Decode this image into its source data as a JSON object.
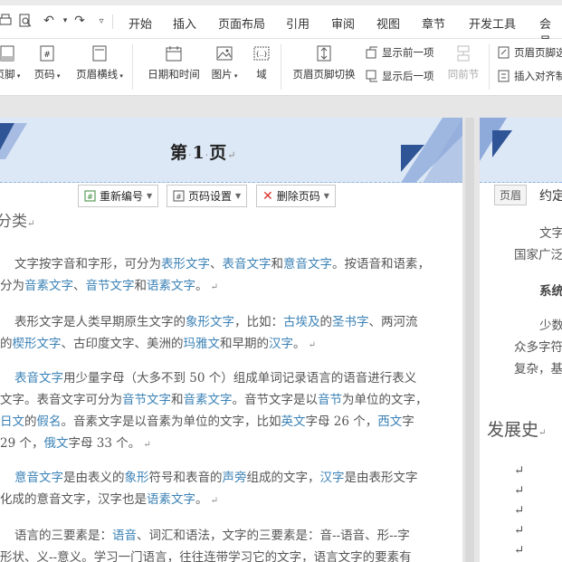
{
  "menubar": {
    "tabs": [
      "开始",
      "插入",
      "页面布局",
      "引用",
      "审阅",
      "视图",
      "章节",
      "开发工具",
      "会员"
    ]
  },
  "ribbon": {
    "footer": "页脚",
    "page_number": "页码",
    "header_line": "页眉横线",
    "date_time": "日期和时间",
    "picture": "图片",
    "field": "域",
    "switch_header_footer": "页眉页脚切换",
    "show_prev": "显示前一项",
    "show_next": "显示后一项",
    "same_as_prev": "同前节",
    "header_footer_options": "页眉页脚选",
    "insert_align_tab": "插入对齐制"
  },
  "page1": {
    "title_prefix": "第",
    "title_number": "1",
    "title_suffix": "页",
    "actions": {
      "renumber": "重新编号",
      "page_number_settings": "页码设置",
      "delete_page_number": "删除页码"
    },
    "heading": "分类",
    "p1": {
      "l1": [
        "文字按字音和字形，可分为",
        "表形文字",
        "、",
        "表音文字",
        "和",
        "意音文字",
        "。按语音和语素，"
      ],
      "l2": [
        "分为",
        "音素文字",
        "、",
        "音节文字",
        "和",
        "语素文字",
        "。"
      ]
    },
    "p2": {
      "l1": [
        "表形文字是人类早期原生文字的",
        "象形文字",
        "，比如：",
        "古埃及",
        "的",
        "圣书字",
        "、两河流"
      ],
      "l2": [
        "的",
        "楔形文字",
        "、古印度文字、美洲的",
        "玛雅文",
        "和早期的",
        "汉字",
        "。"
      ]
    },
    "p3": {
      "l1": [
        "表音文字",
        "用少量字母（大多不到 50 个）组成单词记录语言的语音进行表义"
      ],
      "l2": [
        "文字。表音文字可分为",
        "音节文字",
        "和",
        "音素文字",
        "。音节文字是以",
        "音节",
        "为单位的文字，"
      ],
      "l3": [
        "日文",
        "的",
        "假名",
        "。音素文字是以音素为单位的文字，比如",
        "英文",
        "字母 26 个，",
        "西文",
        "字"
      ],
      "l4": [
        " 29 个，",
        "俄文",
        "字母 33 个。"
      ]
    },
    "p4": {
      "l1": [
        "意音文字",
        "是由表义的",
        "象形",
        "符号和表音的",
        "声旁",
        "组成的文字，",
        "汉字",
        "是由表形文字"
      ],
      "l2": [
        "化成的意音文字，汉字也是",
        "语素文字",
        "。"
      ]
    },
    "p5": {
      "l1": [
        "语言的三要素是：",
        "语音",
        "、词汇和语法，文字的三要素是：音--语音、形--字"
      ],
      "l2": [
        "形状、义--意义。学习一门语言，往往连带学习它的文字，语言文字的要素有"
      ]
    }
  },
  "page2": {
    "header_label": "页眉",
    "header_text": "约定",
    "lines": [
      "文字",
      "国家广泛",
      "系统",
      "少数",
      "众多字符",
      "复杂，基"
    ],
    "heading": "发展史"
  },
  "colors": {
    "link": "#3b82b6",
    "header_band": "#dde8f6",
    "corner_dark": "#2f5597",
    "corner_light": "#8eaadb",
    "delete_icon": "#d9342b"
  }
}
